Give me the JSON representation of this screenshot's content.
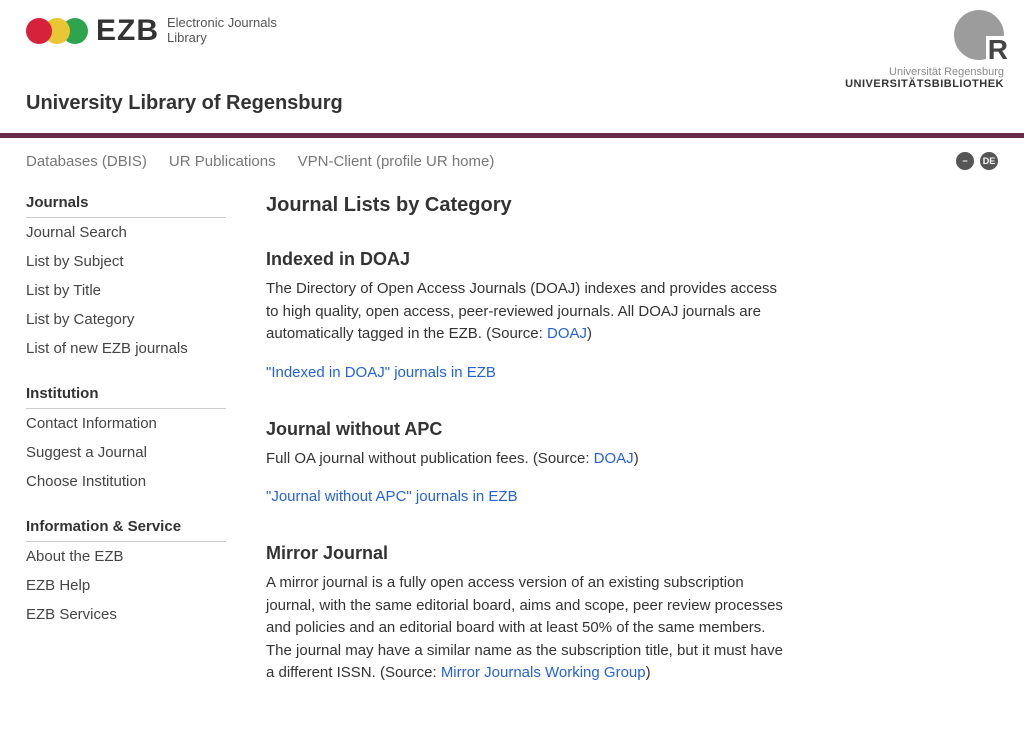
{
  "header": {
    "ezb_abbr": "EZB",
    "ezb_sub1": "Electronic Journals",
    "ezb_sub2": "Library",
    "subtitle": "University Library of Regensburg",
    "ur_tag1": "Universität Regensburg",
    "ur_tag2": "UNIVERSITÄTSBIBLIOTHEK",
    "ur_letter": "R"
  },
  "topnav": {
    "links": [
      "Databases (DBIS)",
      "UR Publications",
      "VPN-Client (profile UR home)"
    ],
    "lang_label": "DE",
    "minus_label": "−"
  },
  "sidebar": {
    "groups": [
      {
        "heading": "Journals",
        "items": [
          "Journal Search",
          "List by Subject",
          "List by Title",
          "List by Category",
          "List of new EZB journals"
        ]
      },
      {
        "heading": "Institution",
        "items": [
          "Contact Information",
          "Suggest a Journal",
          "Choose Institution"
        ]
      },
      {
        "heading": "Information & Service",
        "items": [
          "About the EZB",
          "EZB Help",
          "EZB Services"
        ]
      }
    ]
  },
  "content": {
    "page_title": "Journal Lists by Category",
    "sections": [
      {
        "title": "Indexed in DOAJ",
        "body_before": "The Directory of Open Access Journals (DOAJ) indexes and provides access to high quality, open access, peer-reviewed journals. All DOAJ journals are automatically tagged in the EZB. (Source: ",
        "source_link": "DOAJ",
        "body_after": ")",
        "action_link": "\"Indexed in DOAJ\" journals in EZB"
      },
      {
        "title": "Journal without APC",
        "body_before": "Full OA journal without publication fees. (Source: ",
        "source_link": "DOAJ",
        "body_after": ")",
        "action_link": "\"Journal without APC\" journals in EZB"
      },
      {
        "title": "Mirror Journal",
        "body_before": "A mirror journal is a fully open access version of an existing subscription journal, with the same editorial board, aims and scope, peer review processes and policies and an editorial board with at least 50% of the same members. The journal may have a similar name as the subscription title, but it must have a different ISSN. (Source: ",
        "source_link": "Mirror Journals Working Group",
        "body_after": ")",
        "action_link": ""
      }
    ]
  }
}
